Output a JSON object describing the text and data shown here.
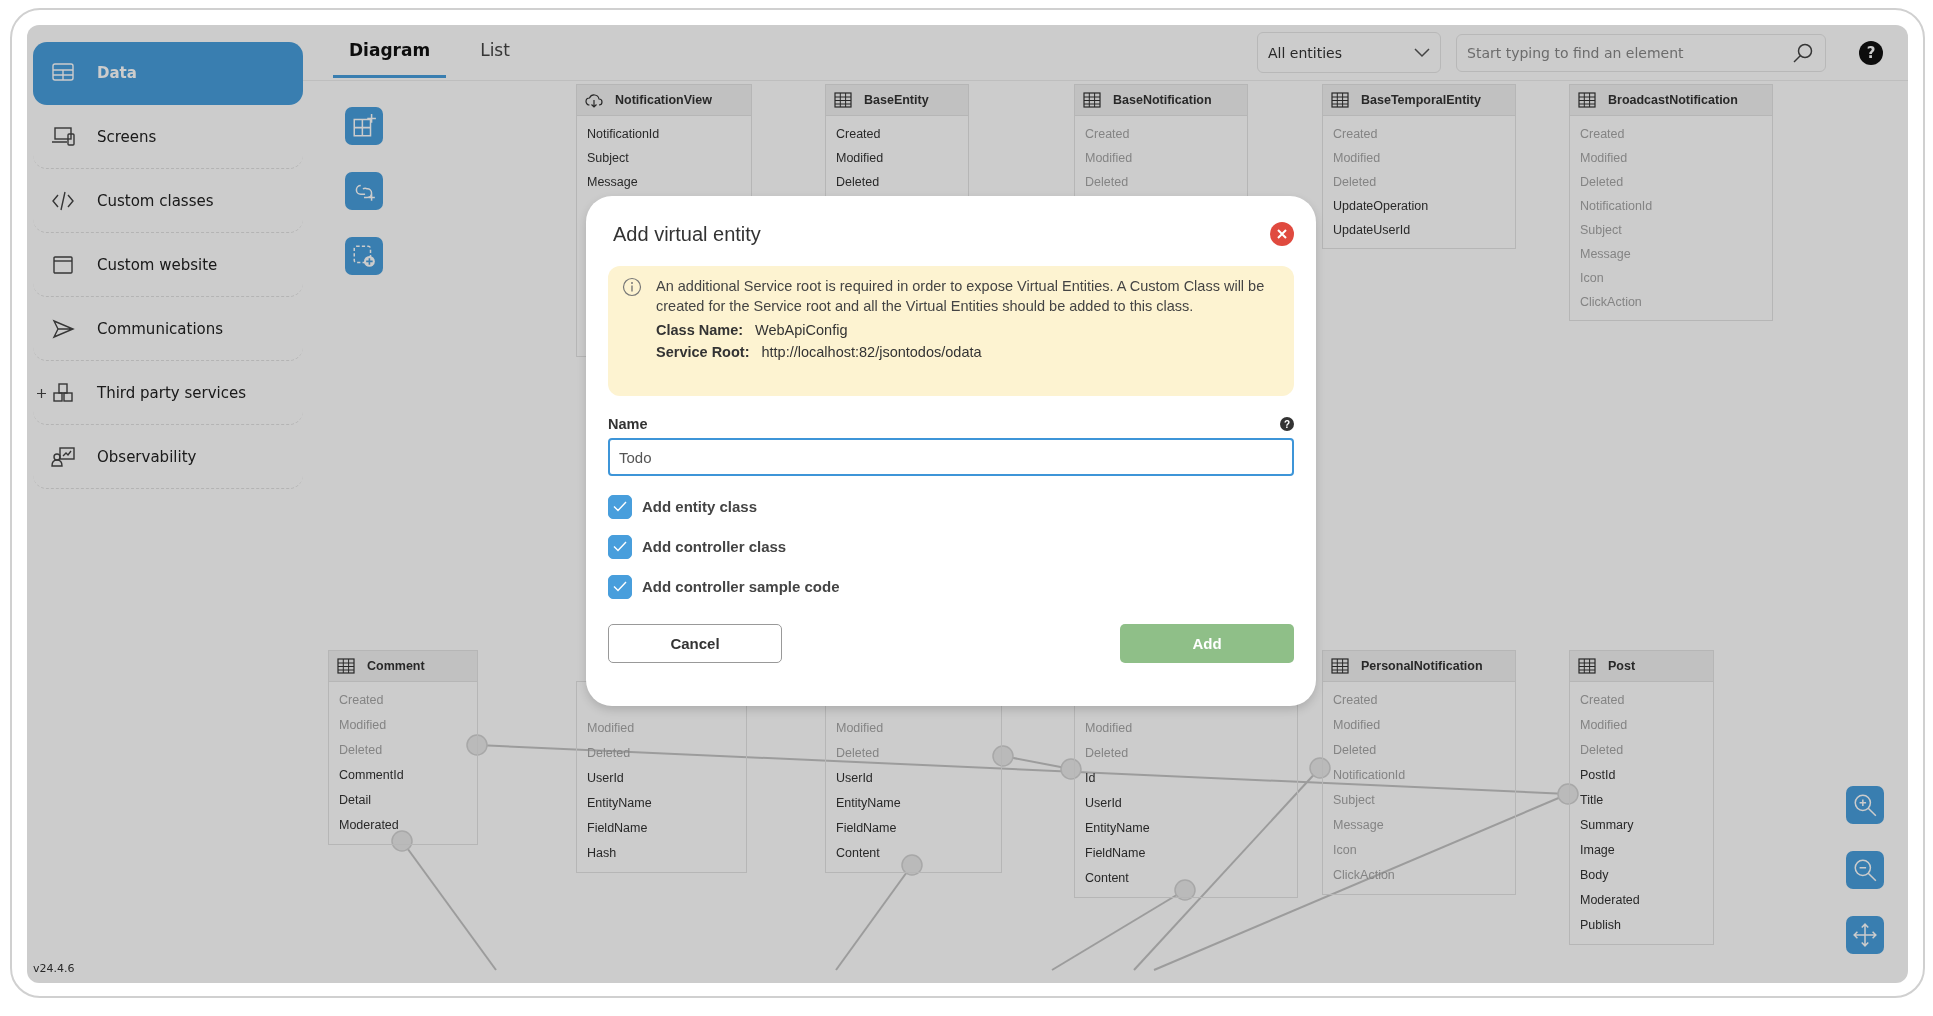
{
  "sidebar": {
    "items": [
      {
        "label": "Data",
        "kind": "table",
        "selected": true,
        "expandable": false
      },
      {
        "label": "Screens",
        "kind": "screens",
        "selected": false,
        "expandable": false
      },
      {
        "label": "Custom classes",
        "kind": "code",
        "selected": false,
        "expandable": false
      },
      {
        "label": "Custom website",
        "kind": "window",
        "selected": false,
        "expandable": false
      },
      {
        "label": "Communications",
        "kind": "send",
        "selected": false,
        "expandable": false
      },
      {
        "label": "Third party services",
        "kind": "services",
        "selected": false,
        "expandable": true
      },
      {
        "label": "Observability",
        "kind": "observability",
        "selected": false,
        "expandable": false
      }
    ],
    "version": "v24.4.6"
  },
  "tabs": [
    {
      "label": "Diagram",
      "selected": true
    },
    {
      "label": "List",
      "selected": false
    }
  ],
  "filter": {
    "value": "All entities"
  },
  "search": {
    "placeholder": "Start typing to find an element"
  },
  "help_icon": "?",
  "entities": [
    {
      "name": "NotificationView",
      "kind": "virtual",
      "fields": [
        {
          "name": "NotificationId",
          "inherited": false
        },
        {
          "name": "Subject",
          "inherited": false
        },
        {
          "name": "Message",
          "inherited": false
        }
      ]
    },
    {
      "name": "BaseEntity",
      "kind": "table",
      "fields": [
        {
          "name": "Created",
          "inherited": false
        },
        {
          "name": "Modified",
          "inherited": false
        },
        {
          "name": "Deleted",
          "inherited": false
        }
      ]
    },
    {
      "name": "BaseNotification",
      "kind": "table",
      "fields": [
        {
          "name": "Created",
          "inherited": true
        },
        {
          "name": "Modified",
          "inherited": true
        },
        {
          "name": "Deleted",
          "inherited": true
        }
      ]
    },
    {
      "name": "BaseTemporalEntity",
      "kind": "table",
      "fields": [
        {
          "name": "Created",
          "inherited": true
        },
        {
          "name": "Modified",
          "inherited": true
        },
        {
          "name": "Deleted",
          "inherited": true
        },
        {
          "name": "UpdateOperation",
          "inherited": false
        },
        {
          "name": "UpdateUserId",
          "inherited": false
        }
      ]
    },
    {
      "name": "BroadcastNotification",
      "kind": "table",
      "fields": [
        {
          "name": "Created",
          "inherited": true
        },
        {
          "name": "Modified",
          "inherited": true
        },
        {
          "name": "Deleted",
          "inherited": true
        },
        {
          "name": "NotificationId",
          "inherited": true
        },
        {
          "name": "Subject",
          "inherited": true
        },
        {
          "name": "Message",
          "inherited": true
        },
        {
          "name": "Icon",
          "inherited": true
        },
        {
          "name": "ClickAction",
          "inherited": true
        }
      ]
    },
    {
      "name": "Comment",
      "kind": "table",
      "fields": [
        {
          "name": "Created",
          "inherited": true
        },
        {
          "name": "Modified",
          "inherited": true
        },
        {
          "name": "Deleted",
          "inherited": true
        },
        {
          "name": "CommentId",
          "inherited": false
        },
        {
          "name": "Detail",
          "inherited": false
        },
        {
          "name": "Moderated",
          "inherited": false
        }
      ]
    },
    {
      "fields": [
        {
          "name": "Modified",
          "inherited": true
        },
        {
          "name": "Deleted",
          "inherited": true
        },
        {
          "name": "UserId",
          "inherited": false
        },
        {
          "name": "EntityName",
          "inherited": false
        },
        {
          "name": "FieldName",
          "inherited": false
        },
        {
          "name": "Hash",
          "inherited": false
        }
      ]
    },
    {
      "fields": [
        {
          "name": "Modified",
          "inherited": true
        },
        {
          "name": "Deleted",
          "inherited": true
        },
        {
          "name": "UserId",
          "inherited": false
        },
        {
          "name": "EntityName",
          "inherited": false
        },
        {
          "name": "FieldName",
          "inherited": false
        },
        {
          "name": "Content",
          "inherited": false
        }
      ]
    },
    {
      "fields": [
        {
          "name": "Modified",
          "inherited": true
        },
        {
          "name": "Deleted",
          "inherited": true
        },
        {
          "name": "Id",
          "inherited": false
        },
        {
          "name": "UserId",
          "inherited": false
        },
        {
          "name": "EntityName",
          "inherited": false
        },
        {
          "name": "FieldName",
          "inherited": false
        },
        {
          "name": "Content",
          "inherited": false
        }
      ]
    },
    {
      "name": "PersonalNotification",
      "kind": "table",
      "fields": [
        {
          "name": "Created",
          "inherited": true
        },
        {
          "name": "Modified",
          "inherited": true
        },
        {
          "name": "Deleted",
          "inherited": true
        },
        {
          "name": "NotificationId",
          "inherited": true
        },
        {
          "name": "Subject",
          "inherited": true
        },
        {
          "name": "Message",
          "inherited": true
        },
        {
          "name": "Icon",
          "inherited": true
        },
        {
          "name": "ClickAction",
          "inherited": true
        }
      ]
    },
    {
      "name": "Post",
      "kind": "table",
      "fields": [
        {
          "name": "Created",
          "inherited": true
        },
        {
          "name": "Modified",
          "inherited": true
        },
        {
          "name": "Deleted",
          "inherited": true
        },
        {
          "name": "PostId",
          "inherited": false
        },
        {
          "name": "Title",
          "inherited": false
        },
        {
          "name": "Summary",
          "inherited": false
        },
        {
          "name": "Image",
          "inherited": false
        },
        {
          "name": "Body",
          "inherited": false
        },
        {
          "name": "Moderated",
          "inherited": false
        },
        {
          "name": "Publish",
          "inherited": false
        }
      ]
    }
  ],
  "dialog": {
    "title": "Add virtual entity",
    "notice": {
      "text": "An additional Service root is required in order to expose Virtual Entities. A Custom Class will be created for the Service root and all the Virtual Entities should be added to this class.",
      "details": [
        {
          "label": "Class Name:",
          "value": "WebApiConfig"
        },
        {
          "label": "Service Root:",
          "value": "http://localhost:82/jsontodos/odata"
        }
      ]
    },
    "name_label": "Name",
    "help_icon": "?",
    "name_value": "Todo",
    "options": [
      {
        "label": "Add entity class",
        "checked": true
      },
      {
        "label": "Add controller class",
        "checked": true
      },
      {
        "label": "Add controller sample code",
        "checked": true
      }
    ],
    "buttons": [
      {
        "label": "Cancel",
        "kind": "secondary"
      },
      {
        "label": "Add",
        "kind": "primary"
      }
    ]
  }
}
